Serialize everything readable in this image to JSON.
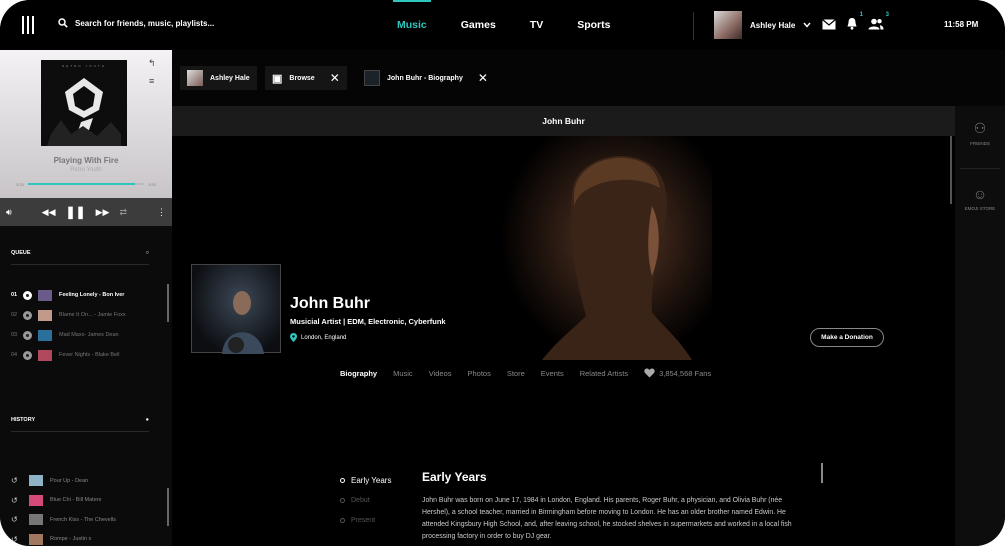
{
  "search": {
    "placeholder": "Search for friends, music, playlists..."
  },
  "nav": {
    "tabs": [
      "Music",
      "Games",
      "TV",
      "Sports"
    ],
    "active": 0
  },
  "user": {
    "name": "Ashley Hale",
    "messages_badge": "",
    "notifications_badge": "1",
    "friends_badge": "3"
  },
  "clock": "11:58 PM",
  "player": {
    "album_art_text": "RETRO YOUTH",
    "title": "Playing With Fire",
    "artist": "Retro Youth",
    "elapsed": "3:33",
    "duration": "3:53",
    "progress": 0.92
  },
  "queue": {
    "label": "QUEUE",
    "items": [
      {
        "n": "01",
        "title": "Feeling Lonely - Bon Iver"
      },
      {
        "n": "02",
        "title": "Blame It On... - Jamie Foxx"
      },
      {
        "n": "03",
        "title": "Mad Maxx- James Dean"
      },
      {
        "n": "04",
        "title": "Fever Nights - Blake Bell"
      }
    ]
  },
  "history": {
    "label": "HISTORY",
    "items": [
      "Pour Up - Dean",
      "Blue Chi - Bill Maters",
      "French Kiss - The Chevells",
      "Rompe - Justin x"
    ]
  },
  "tabs": [
    {
      "label": "Ashley Hale"
    },
    {
      "label": "Browse"
    },
    {
      "label": "John Buhr - Biography"
    }
  ],
  "page_title": "John Buhr",
  "rail": {
    "friends": "FRIENDS",
    "emoji": "EMOJI STORE"
  },
  "artist": {
    "name": "John Buhr",
    "genre": "Musicial Artist | EDM, Electronic, Cyberfunk",
    "location": "London, England",
    "donate": "Make a Donation",
    "fans": "3,854,568 Fans"
  },
  "subtabs": [
    "Biography",
    "Music",
    "Videos",
    "Photos",
    "Store",
    "Events",
    "Related Artists"
  ],
  "timeline": [
    "Early Years",
    "Debut",
    "Present"
  ],
  "bio": {
    "heading": "Early Years",
    "text": "John Buhr was born on June 17, 1984 in London, England. His parents, Roger Buhr, a physician, and Olivia Buhr (née Hershel), a school teacher, married in Birmingham before moving to London. He has an older brother named Edwin. He attended Kingsbury High School, and, after leaving school, he stocked shelves in supermarkets and worked in a local fish processing factory in order to buy DJ gear."
  },
  "colors": {
    "accent": "#2ec6be",
    "background": "#000000"
  }
}
